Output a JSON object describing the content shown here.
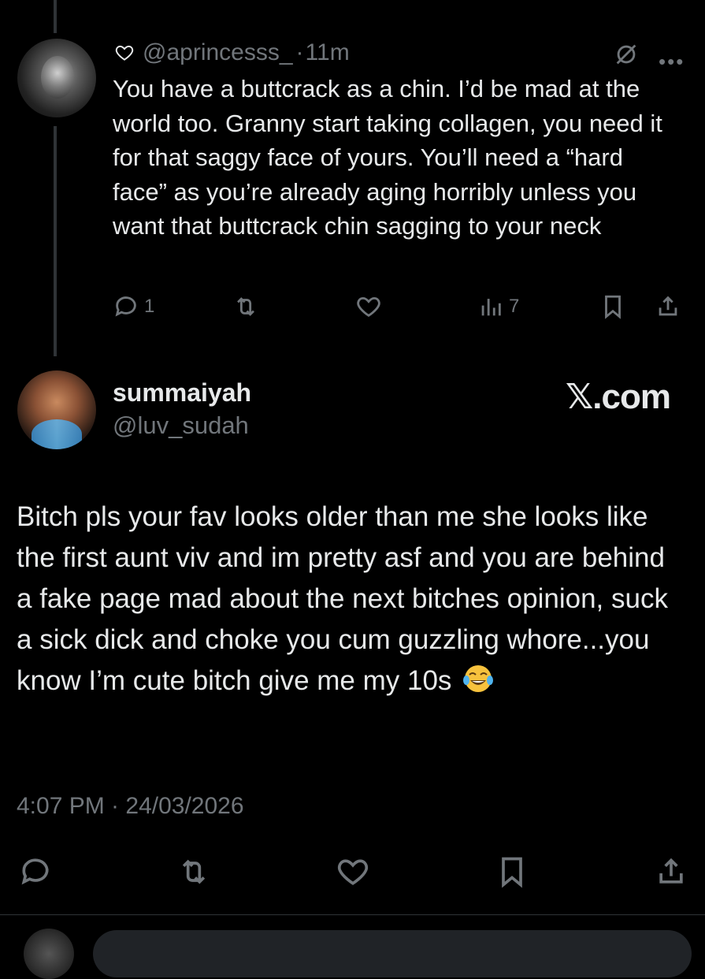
{
  "reply": {
    "handle": "@aprincesss_",
    "separator": "·",
    "time": "11m",
    "text": "You have a buttcrack as a chin. I’d be mad at the world too. Granny start taking collagen, you need it for that saggy face of yours. You’ll need a “hard face” as you’re already aging horribly unless you want that buttcrack chin sagging to your neck",
    "actions": {
      "reply_count": "1",
      "retweet_count": "",
      "like_count": "",
      "views_count": "7"
    }
  },
  "main": {
    "name": "summaiyah",
    "handle": "@luv_sudah",
    "watermark": "𝕏.com",
    "text": "Bitch pls your fav looks older than me she looks like the first aunt viv and im pretty asf and you are behind a fake page mad about the next bitches opinion, suck a sick dick and choke you cum guzzling whore...you know I’m cute bitch give me my 10s",
    "emoji": "😂",
    "timestamp": "4:07 PM · 24/03/2026"
  },
  "colors": {
    "background": "#000000",
    "text": "#e7e9ea",
    "muted": "#71767b",
    "divider": "#2f3336"
  }
}
